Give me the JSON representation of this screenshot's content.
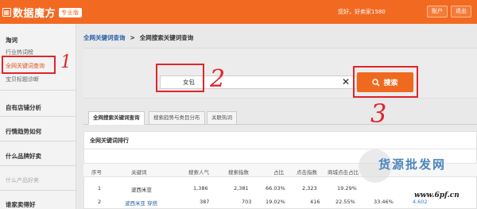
{
  "header": {
    "app_title": "数据魔方",
    "badge": "专业版",
    "welcome": "您好，好卖家1580",
    "buttons": [
      "账户",
      "退出"
    ]
  },
  "sidebar": {
    "items": [
      {
        "label": "淘词",
        "kind": "head"
      },
      {
        "label": "行业热词榜",
        "kind": "item"
      },
      {
        "label": "全网关键词查询",
        "kind": "active"
      },
      {
        "label": "宝贝标题诊断",
        "kind": "item"
      },
      {
        "label": "自有店铺分析",
        "kind": "head"
      },
      {
        "label": "行情趋势如何",
        "kind": "head"
      },
      {
        "label": "什么品牌好卖",
        "kind": "head"
      },
      {
        "label": "什么产品好卖",
        "kind": "dim"
      },
      {
        "label": "谁家卖得好",
        "kind": "head"
      }
    ]
  },
  "breadcrumb": {
    "link": "全网关键词查询",
    "separator": ">",
    "current": "全网搜索关键词查询"
  },
  "search": {
    "value": "女包",
    "clear_icon": "close-icon",
    "button_label": "搜索"
  },
  "tabs": [
    {
      "label": "全网搜索关键词查询",
      "active": true
    },
    {
      "label": "搜索趋势与类目分布",
      "active": false
    },
    {
      "label": "关联热词",
      "active": false
    }
  ],
  "table": {
    "title": "全网关键词排行",
    "columns": [
      "序号",
      "关键词",
      "搜索人气",
      "搜索指数",
      "占比",
      "点击指数",
      "商城点击占比",
      "点击率",
      "转化率"
    ],
    "rows": [
      [
        "1",
        "波西米亚",
        "1,386",
        "2,381",
        "66.03%",
        "2,323",
        "19.29%",
        "",
        ""
      ],
      [
        "2",
        "波西米亚 穿搭",
        "387",
        "703",
        "19.02%",
        "416",
        "22.55%",
        "33.46%",
        "4.602"
      ]
    ]
  },
  "annotations": {
    "num1": "1",
    "num2": "2",
    "num3": "3"
  },
  "watermark": {
    "text": "货源批发网",
    "url": "www.6pf.cn"
  },
  "colors": {
    "brand": "#f26a21",
    "annotation": "#e0262b",
    "link": "#2a62a8"
  }
}
